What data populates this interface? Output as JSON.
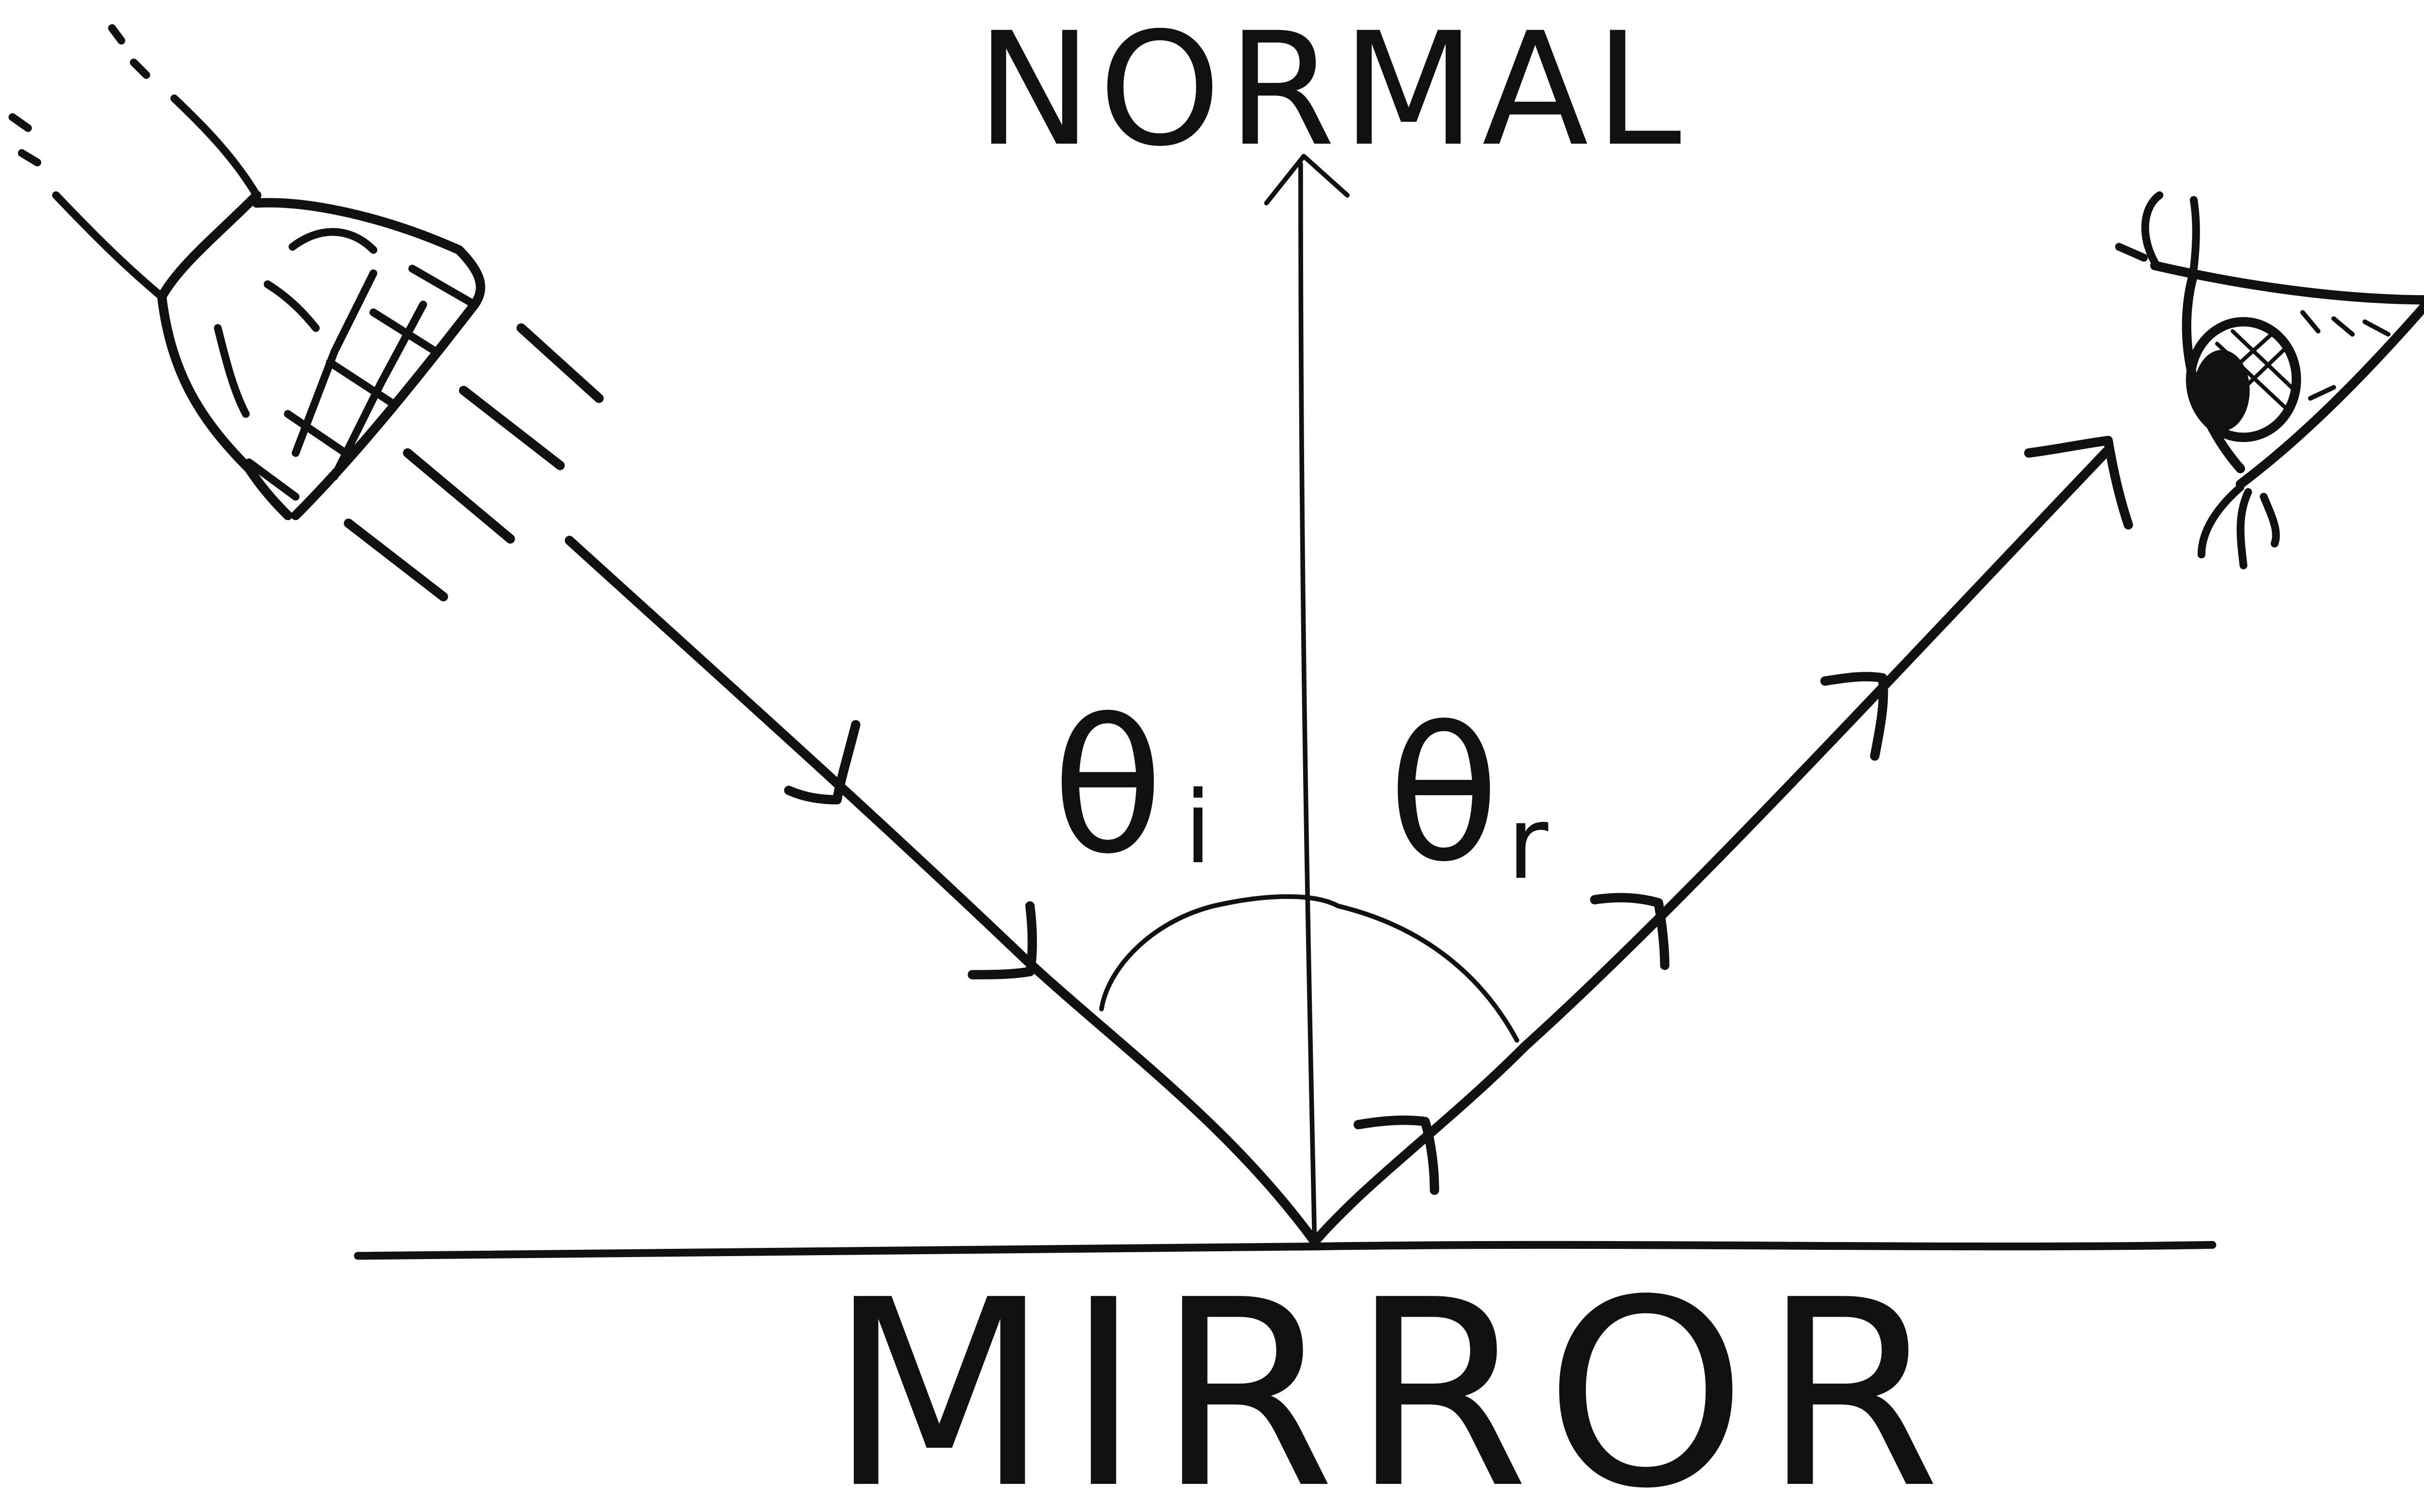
{
  "labels": {
    "normal": "NORMAL",
    "mirror": "MIRROR",
    "theta_symbol": "θ",
    "incident_subscript": "i",
    "reflected_subscript": "r"
  },
  "colors": {
    "ink": "#111111",
    "background": "#ffffff"
  },
  "icons": {
    "light_source": "flashlight-icon",
    "observer": "eye-icon"
  }
}
